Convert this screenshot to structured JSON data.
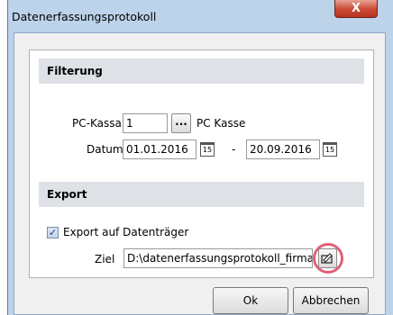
{
  "window": {
    "title": "Datenerfassungsprotokoll",
    "close_label": "X"
  },
  "filterung": {
    "header": "Filterung",
    "pc_kassa_label": "PC-Kassa",
    "pc_kassa_value": "1",
    "browse_label": "...",
    "pc_kassa_name": "PC Kasse",
    "datum_label": "Datum",
    "date_from": "01.01.2016",
    "date_separator": "-",
    "date_to": "20.09.2016",
    "calendar_glyph": "15"
  },
  "export": {
    "header": "Export",
    "checkbox_label": "Export auf Datenträger",
    "checked": true,
    "ziel_label": "Ziel",
    "ziel_value": "D:\\datenerfassungsprotokoll_firma"
  },
  "buttons": {
    "ok": "Ok",
    "cancel": "Abbrechen"
  }
}
